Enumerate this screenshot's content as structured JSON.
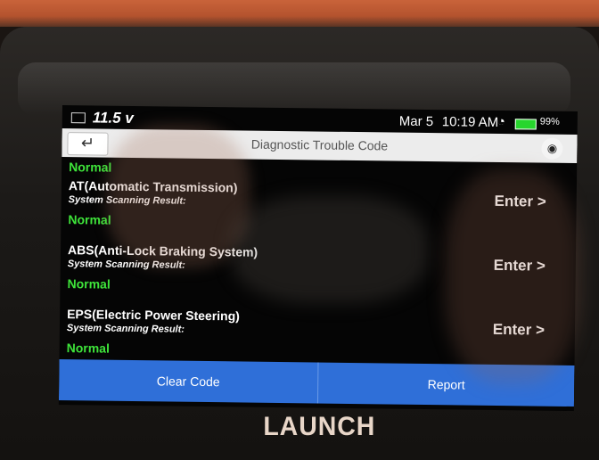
{
  "status_bar": {
    "voltage": "11.5 v",
    "date": "Mar 5",
    "time": "10:19 AM",
    "battery_percent": "99%",
    "battery_color": "#27d62d"
  },
  "header": {
    "title": "Diagnostic Trouble Code",
    "back_icon": "back-arrow-icon",
    "screenshot_icon": "camera-icon"
  },
  "list": {
    "first_result": "Normal",
    "systems": [
      {
        "name": "AT(Automatic Transmission)",
        "sub": "System Scanning Result:",
        "result": "Normal",
        "action": "Enter >"
      },
      {
        "name": "ABS(Anti-Lock Braking System)",
        "sub": "System Scanning Result:",
        "result": "Normal",
        "action": "Enter >"
      },
      {
        "name": "EPS(Electric Power Steering)",
        "sub": "System Scanning Result:",
        "result": "Normal",
        "action": "Enter >"
      }
    ]
  },
  "footer": {
    "clear_code": "Clear Code",
    "report": "Report",
    "accent": "#2f6fd8"
  },
  "device": {
    "brand": "LAUNCH"
  }
}
